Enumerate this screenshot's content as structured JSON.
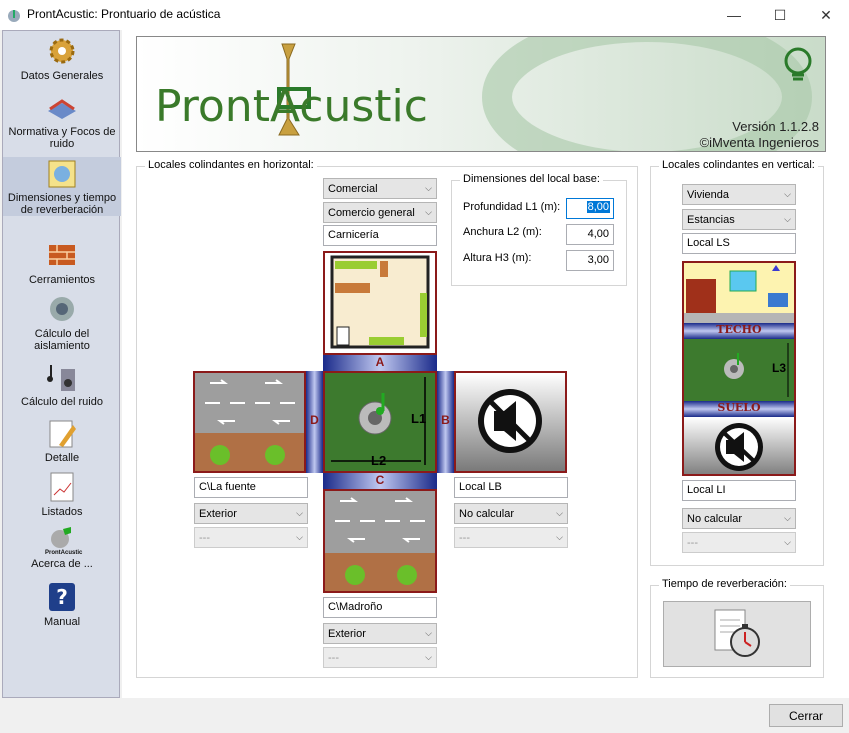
{
  "window": {
    "title": "ProntAcustic: Prontuario de acústica",
    "minimize": "—",
    "maximize": "☐",
    "close": "✕"
  },
  "sidebar": {
    "items": [
      {
        "label": "Datos Generales",
        "icon": "gear-icon"
      },
      {
        "label": "Normativa y Focos de ruido",
        "icon": "book-icon"
      },
      {
        "label": "Dimensiones y tiempo de reverberación",
        "icon": "ruler-icon"
      },
      {
        "label": "Cerramientos",
        "icon": "bricks-icon"
      },
      {
        "label": "Cálculo del aislamiento",
        "icon": "speaker-icon"
      },
      {
        "label": "Cálculo del ruido",
        "icon": "music-speaker-icon"
      },
      {
        "label": "Detalle",
        "icon": "detail-icon"
      },
      {
        "label": "Listados",
        "icon": "chart-list-icon"
      },
      {
        "label": "Acerca de ...",
        "icon": "about-icon",
        "sublabel": "ProntAcustic"
      },
      {
        "label": "Manual",
        "icon": "help-icon"
      }
    ]
  },
  "banner": {
    "logo": "ProntAcustic",
    "version": "Versión 1.1.2.8",
    "company": "©iMventa Ingenieros"
  },
  "horizontal": {
    "title": "Locales colindantes en horizontal:",
    "top": {
      "use": "Comercial",
      "subuse": "Comercio general",
      "name": "Carnicería"
    },
    "left": {
      "name": "C\\La fuente",
      "type": "Exterior",
      "extra": "---"
    },
    "right": {
      "name": "Local LB",
      "type": "No calcular",
      "extra": "---"
    },
    "bottom": {
      "name": "C\\Madroño",
      "type": "Exterior",
      "extra": "---"
    },
    "labels": {
      "a": "A",
      "b": "B",
      "c": "C",
      "d": "D",
      "l1": "L1",
      "l2": "L2"
    }
  },
  "dims": {
    "title": "Dimensiones del local base:",
    "l1_label": "Profundidad L1 (m):",
    "l1": "8,00",
    "l2_label": "Anchura L2 (m):",
    "l2": "4,00",
    "h3_label": "Altura H3 (m):",
    "h3": "3,00"
  },
  "vertical": {
    "title": "Locales colindantes en vertical:",
    "use": "Vivienda",
    "subuse": "Estancias",
    "upper_name": "Local LS",
    "techo": "TECHO",
    "suelo": "SUELO",
    "l3": "L3",
    "lower_name": "Local LI",
    "lower_type": "No calcular",
    "lower_extra": "---"
  },
  "reverb": {
    "title": "Tiempo de reverberación:"
  },
  "footer": {
    "close": "Cerrar"
  },
  "colors": {
    "frame": "#8b1a1a",
    "band": "#1a2a8a",
    "green": "#3d7a2e",
    "accent": "#0078d7"
  }
}
